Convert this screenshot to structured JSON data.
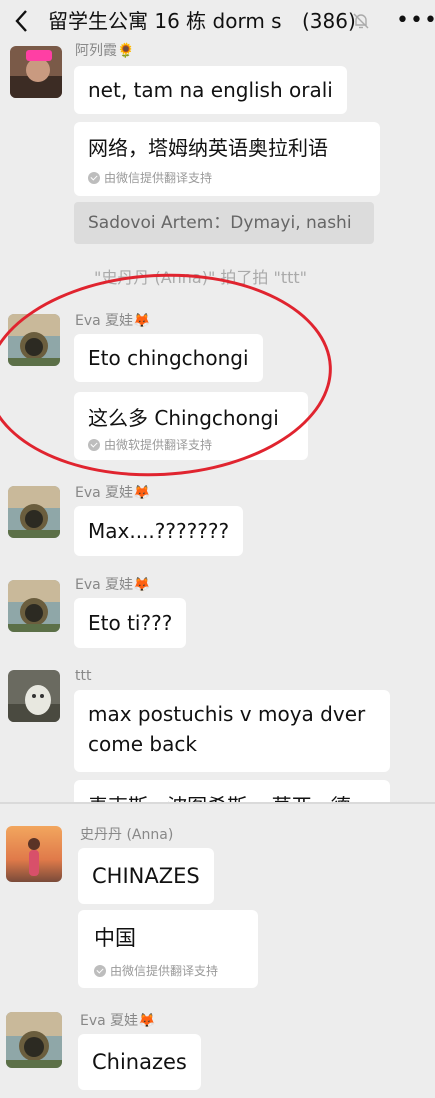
{
  "header": {
    "back_icon": "chevron-left-icon",
    "title": "留学生公寓 16 栋 dorm s",
    "count": "(386)",
    "mute_icon": "bell-off-icon",
    "more_icon": "more-dots-icon"
  },
  "messages": {
    "m1": {
      "name": "阿列霞🌻",
      "bubble": "net, tam na english orali",
      "translation": "网络，塔姆纳英语奥拉利语",
      "translation_note": "由微信提供翻译支持",
      "quote": "Sadovoi Artem：Dymayi, nashi"
    },
    "system": "\"史丹丹 (Anna)\" 拍了拍 \"ttt\"",
    "m2": {
      "name": "Eva 夏娃🦊",
      "bubble": "Eto chingchongi",
      "translation": "这么多 Chingchongi",
      "translation_note": "由微软提供翻译支持"
    },
    "m3": {
      "name": "Eva 夏娃🦊",
      "bubble": "Max....???????"
    },
    "m4": {
      "name": "Eva 夏娃🦊",
      "bubble": "Eto ti???"
    },
    "m5": {
      "name": "ttt",
      "bubble_line1": "max postuchis v moya dver",
      "bubble_line2": "come back",
      "bubble_partial": "麦克斯 · 波图希斯 v 莫亚 · 德"
    },
    "m6": {
      "name": "史丹丹 (Anna)",
      "bubble": "CHINAZES",
      "translation": "中国",
      "translation_note": "由微信提供翻译支持"
    },
    "m7": {
      "name": "Eva 夏娃🦊",
      "bubble": "Chinazes"
    }
  },
  "colors": {
    "background": "#ededed",
    "bubble": "#ffffff",
    "annotation": "#e0242f"
  }
}
